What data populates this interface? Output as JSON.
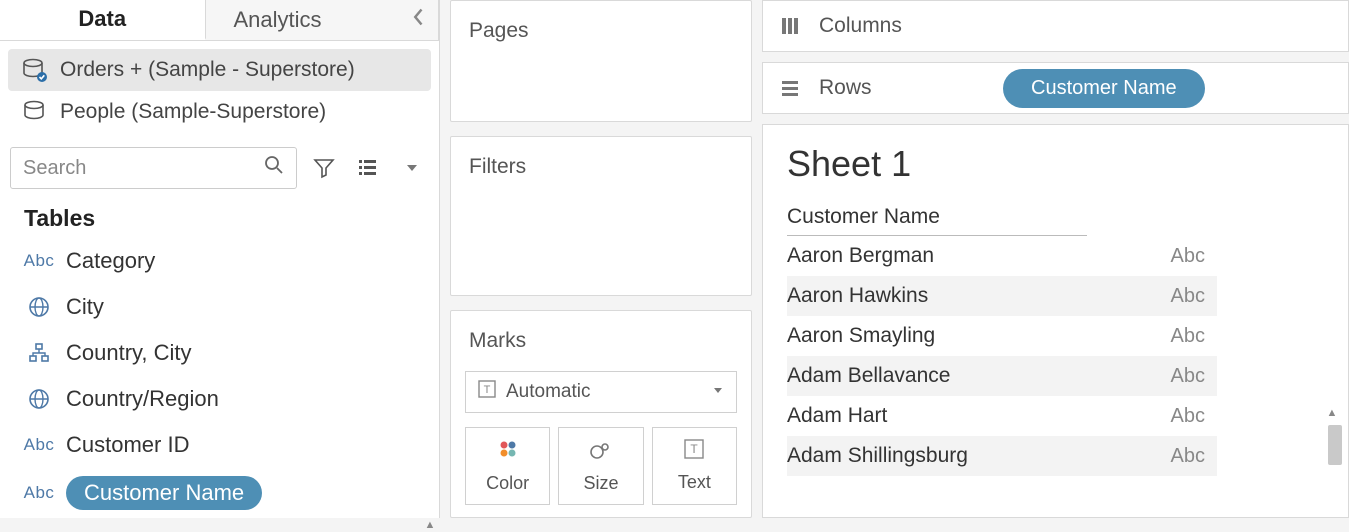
{
  "tabs": {
    "data": "Data",
    "analytics": "Analytics"
  },
  "datasources": [
    {
      "label": "Orders + (Sample - Superstore)",
      "active": true
    },
    {
      "label": "People (Sample-Superstore)",
      "active": false
    }
  ],
  "search": {
    "placeholder": "Search"
  },
  "tables_header": "Tables",
  "fields": [
    {
      "icon": "abc",
      "label": "Category"
    },
    {
      "icon": "globe",
      "label": "City"
    },
    {
      "icon": "hier",
      "label": "Country, City"
    },
    {
      "icon": "globe",
      "label": "Country/Region"
    },
    {
      "icon": "abc",
      "label": "Customer ID"
    },
    {
      "icon": "abc",
      "label": "Customer Name",
      "selected": true
    }
  ],
  "cards": {
    "pages": "Pages",
    "filters": "Filters",
    "marks": "Marks"
  },
  "marks": {
    "type": "Automatic",
    "cells": {
      "color": "Color",
      "size": "Size",
      "text": "Text"
    }
  },
  "shelves": {
    "columns": "Columns",
    "rows": "Rows",
    "rows_pill": "Customer Name"
  },
  "sheet": {
    "title": "Sheet 1",
    "column_header": "Customer Name",
    "abc": "Abc",
    "rows": [
      "Aaron Bergman",
      "Aaron Hawkins",
      "Aaron Smayling",
      "Adam Bellavance",
      "Adam Hart",
      "Adam Shillingsburg"
    ]
  }
}
